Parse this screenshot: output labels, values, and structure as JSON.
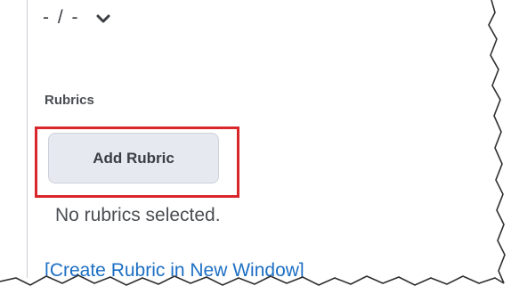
{
  "grade": {
    "value_text": "- / -"
  },
  "rubrics": {
    "section_label": "Rubrics",
    "add_button_label": "Add Rubric",
    "empty_message": "No rubrics selected.",
    "create_link_label": "[Create Rubric in New Window]"
  },
  "colors": {
    "highlight": "#d9262a",
    "link": "#1d6fc4",
    "button_bg": "#e6e9ef"
  },
  "icons": {
    "grade_dropdown": "chevron-down-icon"
  }
}
